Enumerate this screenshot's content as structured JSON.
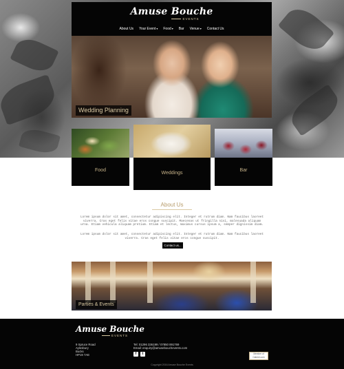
{
  "header": {
    "logo_main": "Amuse Bouche",
    "logo_sub": "EVENTS",
    "nav": [
      {
        "label": "About Us",
        "has_dropdown": false
      },
      {
        "label": "Your Event",
        "has_dropdown": true
      },
      {
        "label": "Food",
        "has_dropdown": true
      },
      {
        "label": "Bar",
        "has_dropdown": false
      },
      {
        "label": "Venue",
        "has_dropdown": true
      },
      {
        "label": "Contact Us",
        "has_dropdown": false
      }
    ]
  },
  "feature": {
    "caption": "Wedding Planning"
  },
  "cards": [
    {
      "label": "Food"
    },
    {
      "label": "Weddings"
    },
    {
      "label": "Bar"
    }
  ],
  "about": {
    "title": "About Us",
    "paragraph1": "Lorem ipsum dolor sit amet, consectetur adipiscing elit. Integer et rutrum diam. Nam faucibus laoreet viverra. Cras eget felis vitae eros congue suscipit. Maecenas ut fringilla nisi, malesuada aliquam urna. Etiam vehicula aliquam pretium. Etiam et lectus, maximus cursus ipsum a, semper dignissim diam.",
    "paragraph2": "Lorem ipsum dolor sit amet, consectetur adipiscing elit. Integer et rutrum diam. Nam faucibus laoreet viverra. Cras eget felis vitae eros congue suscipit.",
    "button_label": "Contact us..."
  },
  "parties": {
    "caption": "Parties & Events"
  },
  "footer": {
    "logo_main": "Amuse Bouche",
    "logo_sub": "EVENTS",
    "address": [
      "9 Spruce Road",
      "Aylesbury",
      "Bucks",
      "HP19 7AE"
    ],
    "tel": "Tel: 01296 336199 / 07850 891769",
    "email": "Email: enquiry@amusebouchevents.com",
    "badge": "Member of Caterer.com",
    "copyright": "Copyright 2016 Amuse Bouche Events"
  },
  "colors": {
    "accent": "#c8b48a",
    "dark": "#050505",
    "heading": "#b79c6b"
  },
  "icons": {
    "social": [
      "facebook-icon",
      "twitter-icon"
    ]
  }
}
